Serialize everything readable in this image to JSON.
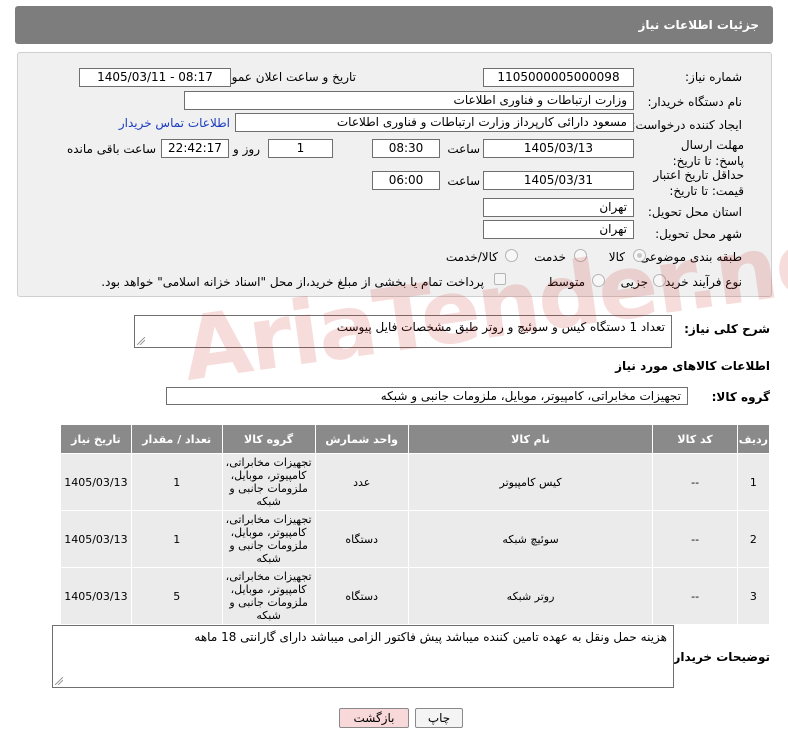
{
  "header": {
    "title": "جزئیات اطلاعات نیاز"
  },
  "form": {
    "need_number_label": "شماره نیاز:",
    "need_number": "1105000005000098",
    "announce_label": "تاریخ و ساعت اعلان عمومی:",
    "announce_value": "1405/03/11 - 08:17",
    "buyer_org_label": "نام دستگاه خریدار:",
    "buyer_org": "وزارت ارتباطات و فناوری اطلاعات",
    "creator_label": "ایجاد کننده درخواست:",
    "creator": "مسعود دارائی کارپرداز وزارت ارتباطات و فناوری اطلاعات",
    "contact_link": "اطلاعات تماس خریدار",
    "deadline_label": "مهلت ارسال پاسخ: تا تاریخ:",
    "deadline_date": "1405/03/13",
    "time_label": "ساعت",
    "deadline_time": "08:30",
    "days_value": "1",
    "days_label": "روز و",
    "remaining_time": "22:42:17",
    "remaining_label": "ساعت باقی مانده",
    "validity_label": "حداقل تاریخ اعتبار قیمت: تا تاریخ:",
    "validity_date": "1405/03/31",
    "validity_time": "06:00",
    "province_label": "استان محل تحویل:",
    "province": "تهران",
    "city_label": "شهر محل تحویل:",
    "city": "تهران",
    "category_label": "طبقه بندی موضوعی:",
    "category_options": [
      "کالا",
      "خدمت",
      "کالا/خدمت"
    ],
    "process_label": "نوع فرآیند خرید :",
    "process_options": [
      "جزیی",
      "متوسط"
    ],
    "payment_note": "پرداخت تمام یا بخشی از مبلغ خرید،از محل \"اسناد خزانه اسلامی\" خواهد بود."
  },
  "description": {
    "label": "شرح کلی نیاز:",
    "text": "تعداد 1 دستگاه کیس و سوئیچ و روتر طبق مشخصات فایل پیوست"
  },
  "goods": {
    "section_title": "اطلاعات کالاهای مورد نیاز",
    "group_label": "گروه کالا:",
    "group_value": "تجهیزات مخابراتی، کامپیوتر، موبایل، ملزومات جانبی و شبکه",
    "columns": [
      "ردیف",
      "کد کالا",
      "نام کالا",
      "واحد شمارش",
      "گروه کالا",
      "تعداد / مقدار",
      "تاریخ نیاز"
    ],
    "rows": [
      {
        "index": "1",
        "code": "--",
        "name": "کیس کامپیوتر",
        "unit": "عدد",
        "group": "تجهیزات مخابراتی، کامپیوتر، موبایل، ملزومات جانبی و شبکه",
        "qty": "1",
        "date": "1405/03/13"
      },
      {
        "index": "2",
        "code": "--",
        "name": "سوئیچ شبکه",
        "unit": "دستگاه",
        "group": "تجهیزات مخابراتی، کامپیوتر، موبایل، ملزومات جانبی و شبکه",
        "qty": "1",
        "date": "1405/03/13"
      },
      {
        "index": "3",
        "code": "--",
        "name": "روتر شبکه",
        "unit": "دستگاه",
        "group": "تجهیزات مخابراتی، کامپیوتر، موبایل، ملزومات جانبی و شبکه",
        "qty": "5",
        "date": "1405/03/13"
      }
    ]
  },
  "buyer_notes": {
    "label": "توضیحات خریدار:",
    "text": "هزینه حمل ونقل به عهده تامین کننده میباشد پیش فاکتور الزامی میباشد دارای گارانتی 18 ماهه"
  },
  "buttons": {
    "print": "چاپ",
    "back": "بازگشت"
  },
  "watermark": "AriaTender.net",
  "colors": {
    "header_bg": "#7d7d7d",
    "table_header_bg": "#8a8a8a",
    "back_button_bg": "#f8d8d8",
    "link": "#1a3cc0"
  }
}
